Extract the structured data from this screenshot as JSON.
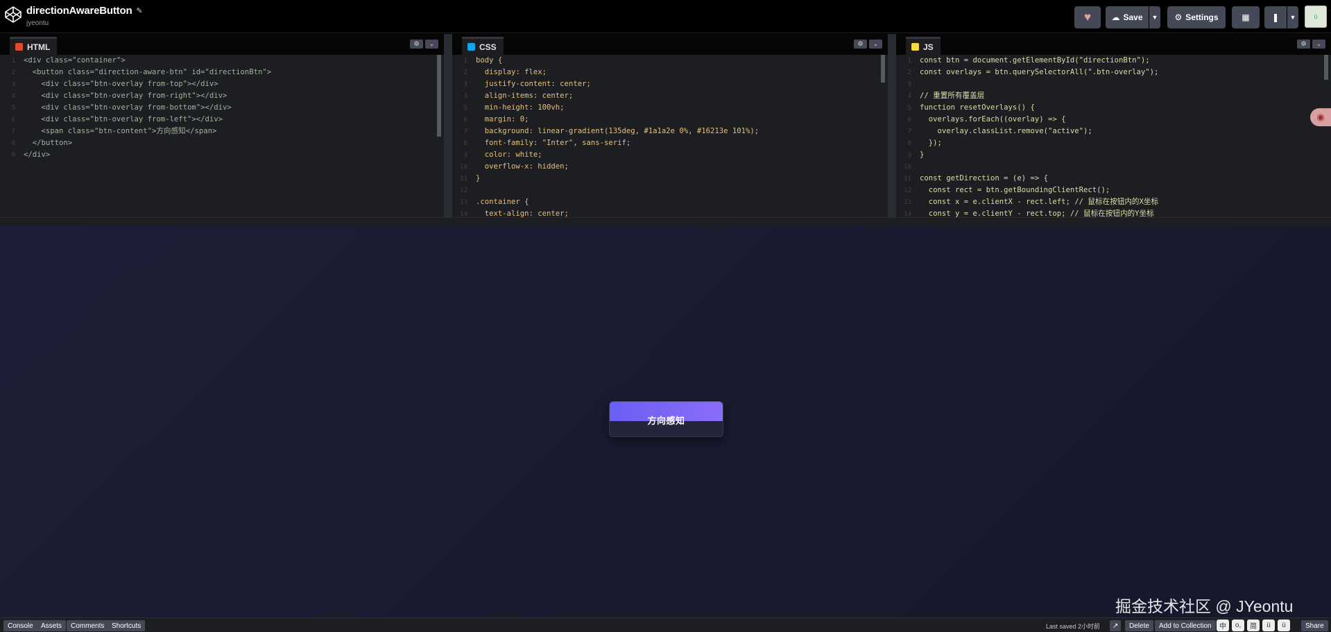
{
  "header": {
    "pen_title": "directionAwareButton",
    "author": "jyeontu",
    "save_label": "Save",
    "settings_label": "Settings",
    "avatar_text": "ü"
  },
  "editors": {
    "html": {
      "tab_label": "HTML",
      "lines": [
        {
          "n": "1",
          "text": "<div class=\"container\">"
        },
        {
          "n": "2",
          "text": "  <button class=\"direction-aware-btn\" id=\"directionBtn\">"
        },
        {
          "n": "3",
          "text": "    <div class=\"btn-overlay from-top\"></div>"
        },
        {
          "n": "4",
          "text": "    <div class=\"btn-overlay from-right\"></div>"
        },
        {
          "n": "5",
          "text": "    <div class=\"btn-overlay from-bottom\"></div>"
        },
        {
          "n": "6",
          "text": "    <div class=\"btn-overlay from-left\"></div>"
        },
        {
          "n": "7",
          "text": "    <span class=\"btn-content\">方向感知</span>"
        },
        {
          "n": "8",
          "text": "  </button>"
        },
        {
          "n": "9",
          "text": "</div>"
        }
      ]
    },
    "css": {
      "tab_label": "CSS",
      "lines": [
        {
          "n": "1",
          "text": "body {"
        },
        {
          "n": "2",
          "text": "  display: flex;"
        },
        {
          "n": "3",
          "text": "  justify-content: center;"
        },
        {
          "n": "4",
          "text": "  align-items: center;"
        },
        {
          "n": "5",
          "text": "  min-height: 100vh;"
        },
        {
          "n": "6",
          "text": "  margin: 0;"
        },
        {
          "n": "7",
          "text": "  background: linear-gradient(135deg, #1a1a2e 0%, #16213e 101%);"
        },
        {
          "n": "8",
          "text": "  font-family: \"Inter\", sans-serif;"
        },
        {
          "n": "9",
          "text": "  color: white;"
        },
        {
          "n": "10",
          "text": "  overflow-x: hidden;"
        },
        {
          "n": "11",
          "text": "}"
        },
        {
          "n": "12",
          "text": ""
        },
        {
          "n": "13",
          "text": ".container {"
        },
        {
          "n": "14",
          "text": "  text-align: center;"
        }
      ]
    },
    "js": {
      "tab_label": "JS",
      "lines": [
        {
          "n": "1",
          "text": "const btn = document.getElementById(\"directionBtn\");"
        },
        {
          "n": "2",
          "text": "const overlays = btn.querySelectorAll(\".btn-overlay\");"
        },
        {
          "n": "3",
          "text": ""
        },
        {
          "n": "4",
          "text": "// 重置所有覆盖层"
        },
        {
          "n": "5",
          "text": "function resetOverlays() {"
        },
        {
          "n": "6",
          "text": "  overlays.forEach((overlay) => {"
        },
        {
          "n": "7",
          "text": "    overlay.classList.remove(\"active\");"
        },
        {
          "n": "8",
          "text": "  });"
        },
        {
          "n": "9",
          "text": "}"
        },
        {
          "n": "10",
          "text": ""
        },
        {
          "n": "11",
          "text": "const getDirection = (e) => {"
        },
        {
          "n": "12",
          "text": "  const rect = btn.getBoundingClientRect();"
        },
        {
          "n": "13",
          "text": "  const x = e.clientX - rect.left; // 鼠标在按钮内的X坐标"
        },
        {
          "n": "14",
          "text": "  const y = e.clientY - rect.top; // 鼠标在按钮内的Y坐标"
        }
      ]
    }
  },
  "preview": {
    "button_label": "方向感知",
    "watermark": "掘金技术社区 @ JYeontu",
    "colors": {
      "overlay_top": "#6a5ff4",
      "button_bg": "#23253b",
      "bg_start": "#1a1a2e",
      "bg_end": "#16213e"
    }
  },
  "footer": {
    "console": "Console",
    "assets": "Assets",
    "comments": "Comments",
    "shortcuts": "Shortcuts",
    "last_saved": "Last saved 2小时前",
    "delete": "Delete",
    "add_to_collection": "Add to Collection",
    "share": "Share",
    "icons": [
      "中",
      "o,",
      "简",
      "ü",
      "ü"
    ]
  }
}
